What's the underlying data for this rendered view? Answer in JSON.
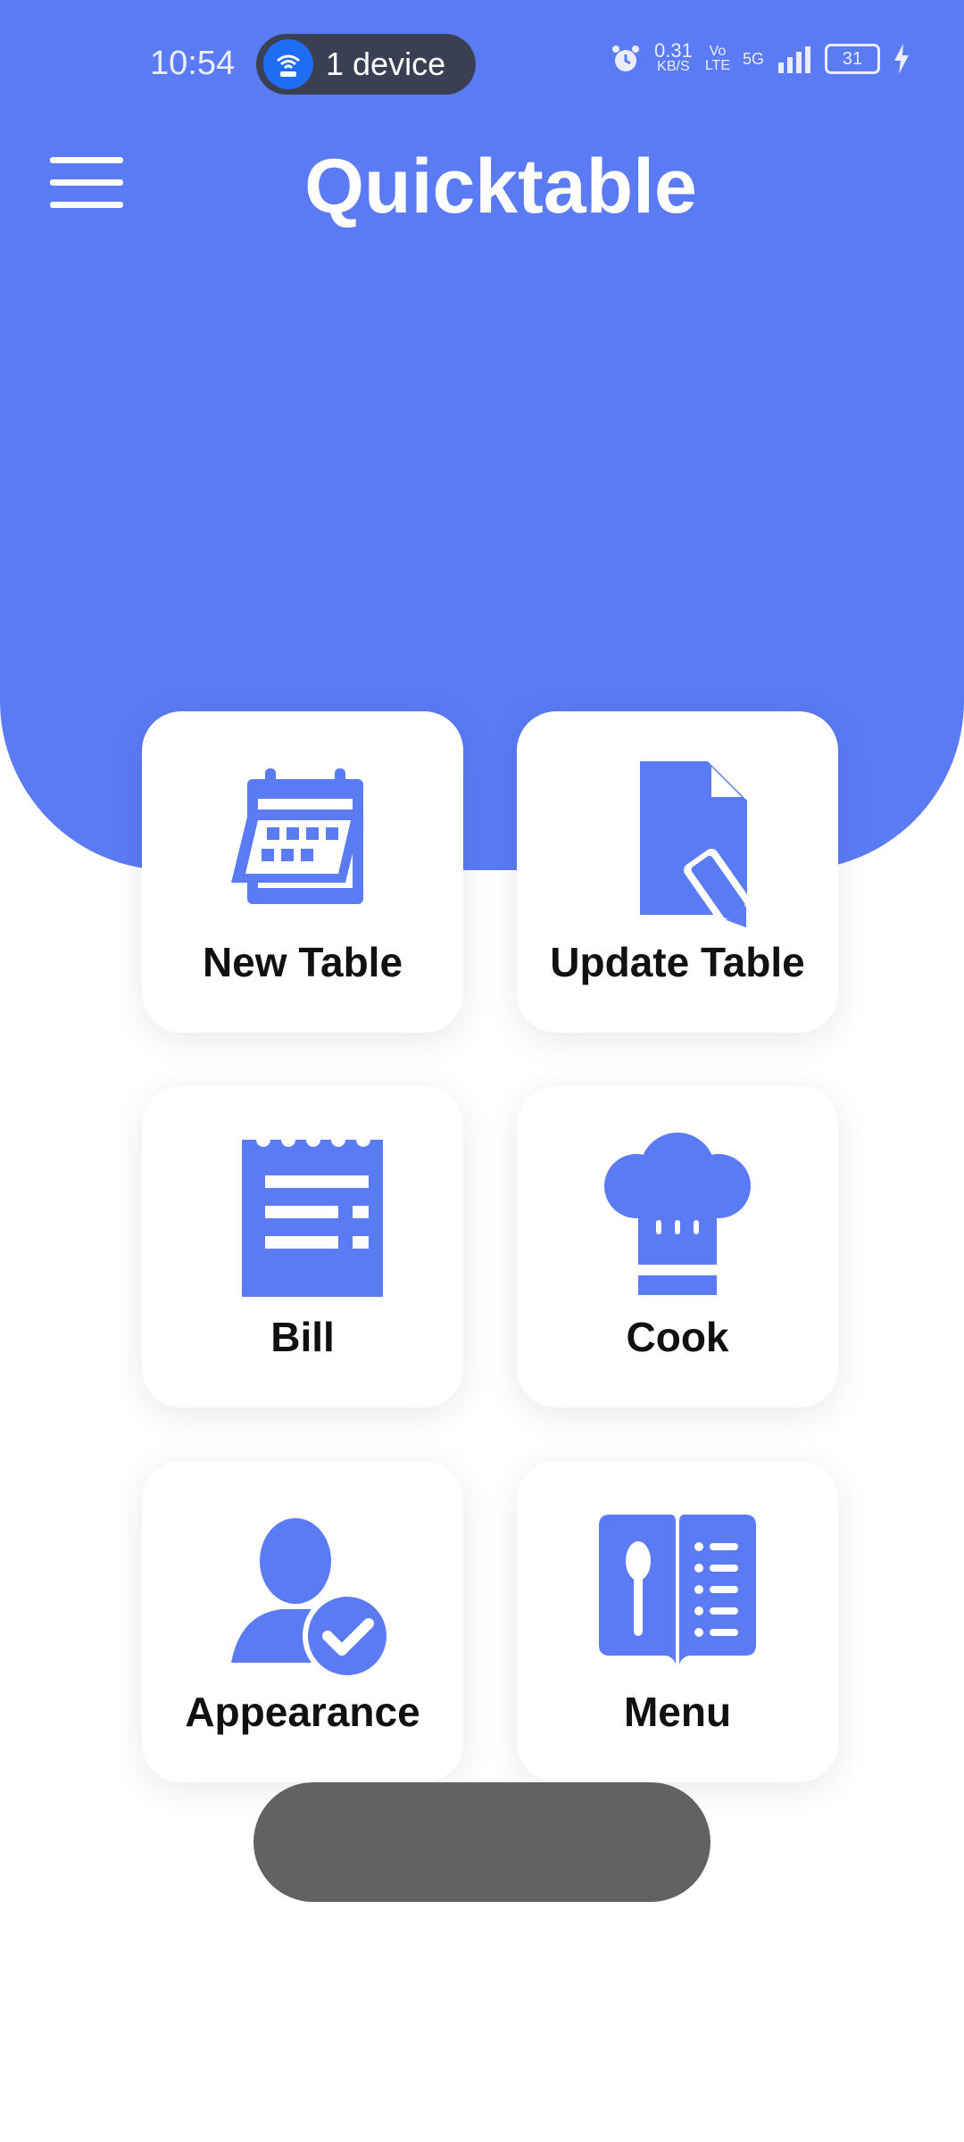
{
  "status_bar": {
    "time": "10:54",
    "hotspot_label": "1 device",
    "net_speed": "0.31",
    "net_speed_unit": "KB/S",
    "volte_top": "Vo",
    "volte_bottom": "LTE",
    "network": "5G",
    "battery": "31"
  },
  "app_bar": {
    "title": "Quicktable",
    "menu_icon": "hamburger-icon"
  },
  "tiles": [
    {
      "label": "New Table",
      "icon": "calendar-icon"
    },
    {
      "label": "Update Table",
      "icon": "document-edit-icon"
    },
    {
      "label": "Bill",
      "icon": "receipt-icon"
    },
    {
      "label": "Cook",
      "icon": "chef-hat-icon"
    },
    {
      "label": "Appearance",
      "icon": "user-check-icon"
    },
    {
      "label": "Menu",
      "icon": "menu-book-icon"
    }
  ],
  "colors": {
    "accent": "#5b7bf5",
    "tile_bg": "#ffffff",
    "label": "#111111",
    "pill": "#626262"
  }
}
